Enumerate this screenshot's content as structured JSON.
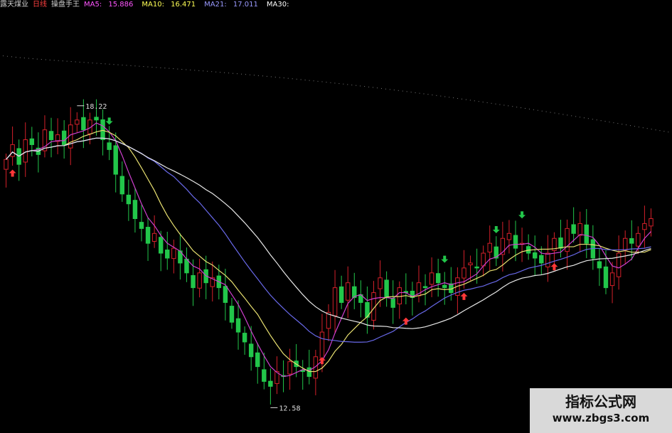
{
  "header": {
    "stock_name": "露天煤业",
    "period": "日线",
    "indicator": "操盘手王",
    "ma5_label": "MA5:",
    "ma5_value": "15.886",
    "ma10_label": "MA10:",
    "ma10_value": "16.471",
    "ma21_label": "MA21:",
    "ma21_value": "17.011",
    "ma30_label": "MA30:",
    "ma30_value": ""
  },
  "colors": {
    "up": "#d4202a",
    "down": "#22c64a",
    "ma5": "#e8e8e8",
    "ma10": "#e8e070",
    "ma21": "#d040d0",
    "ma30": "#6868e8",
    "long_ma": "#c8c8c8",
    "buy_arrow": "#ff3838",
    "sell_arrow": "#22c64a",
    "label": "#dddddd"
  },
  "chart_data": {
    "type": "candlestick",
    "ylim": [
      12.0,
      20.0
    ],
    "annotations": {
      "high": "18.22",
      "low": "12.58"
    },
    "closes": [
      17.2,
      17.5,
      17.1,
      17.6,
      17.5,
      17.3,
      17.8,
      17.6,
      17.7,
      17.5,
      17.9,
      18.0,
      17.8,
      18.0,
      18.0,
      17.6,
      17.4,
      16.9,
      16.5,
      16.3,
      16.0,
      15.8,
      15.5,
      15.7,
      15.3,
      15.2,
      15.4,
      15.1,
      14.9,
      14.6,
      14.9,
      14.7,
      14.8,
      14.6,
      14.3,
      13.9,
      13.7,
      13.5,
      13.2,
      13.0,
      12.7,
      12.6,
      12.9,
      12.8,
      13.1,
      13.0,
      12.9,
      12.8,
      13.2,
      13.7,
      14.1,
      14.6,
      14.3,
      14.7,
      14.4,
      14.3,
      14.0,
      14.5,
      14.8,
      14.4,
      14.2,
      14.6,
      14.5,
      14.4,
      14.7,
      14.6,
      14.9,
      14.7,
      14.6,
      14.5,
      14.8,
      15.0,
      15.1,
      15.0,
      15.3,
      15.5,
      15.2,
      15.6,
      15.7,
      15.4,
      15.5,
      15.3,
      15.2,
      15.1,
      15.3,
      15.6,
      15.4,
      15.8,
      15.7,
      15.9,
      15.5,
      15.2,
      15.0,
      14.6,
      14.9,
      15.3,
      15.6,
      15.5,
      15.7,
      15.9,
      16.0
    ],
    "moving_averages": [
      "MA5",
      "MA10",
      "MA21",
      "MA30"
    ],
    "buy_signals": [
      1,
      49,
      62,
      71,
      85
    ],
    "sell_signals": [
      16,
      68,
      76,
      80
    ]
  },
  "watermark": {
    "title": "指标公式网",
    "url": "www.zbgs3.com"
  }
}
